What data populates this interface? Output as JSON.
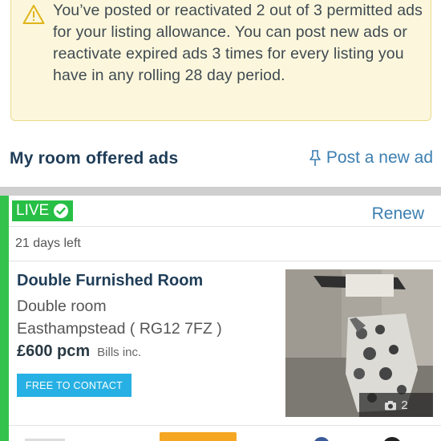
{
  "notice": {
    "icon": "warning-triangle-icon",
    "text": "You’ve posted or reactivated 2 out of 3 permitted ads for your listing allowance. You can post new ads or reactivate expired ads 3 times for every listing you have in any rolling 28 day period."
  },
  "section": {
    "title": "My room offered ads",
    "post_link": "Post a new ad",
    "post_icon": "pin-icon"
  },
  "ad": {
    "status": "LIVE",
    "renew": "Renew",
    "days_left": "21 days left",
    "title": "Double Furnished Room",
    "room_type": "Double room",
    "location": "Easthampstead ( RG12 7FZ )",
    "price": "£600 pcm",
    "bills": "Bills inc.",
    "contact_button": "FREE TO CONTACT",
    "photo_count": "2"
  },
  "colors": {
    "accent_green": "#27bf45",
    "link_blue": "#3d7fb0",
    "contact_blue": "#27b0e3",
    "notice_bg": "#fcf7dc"
  }
}
